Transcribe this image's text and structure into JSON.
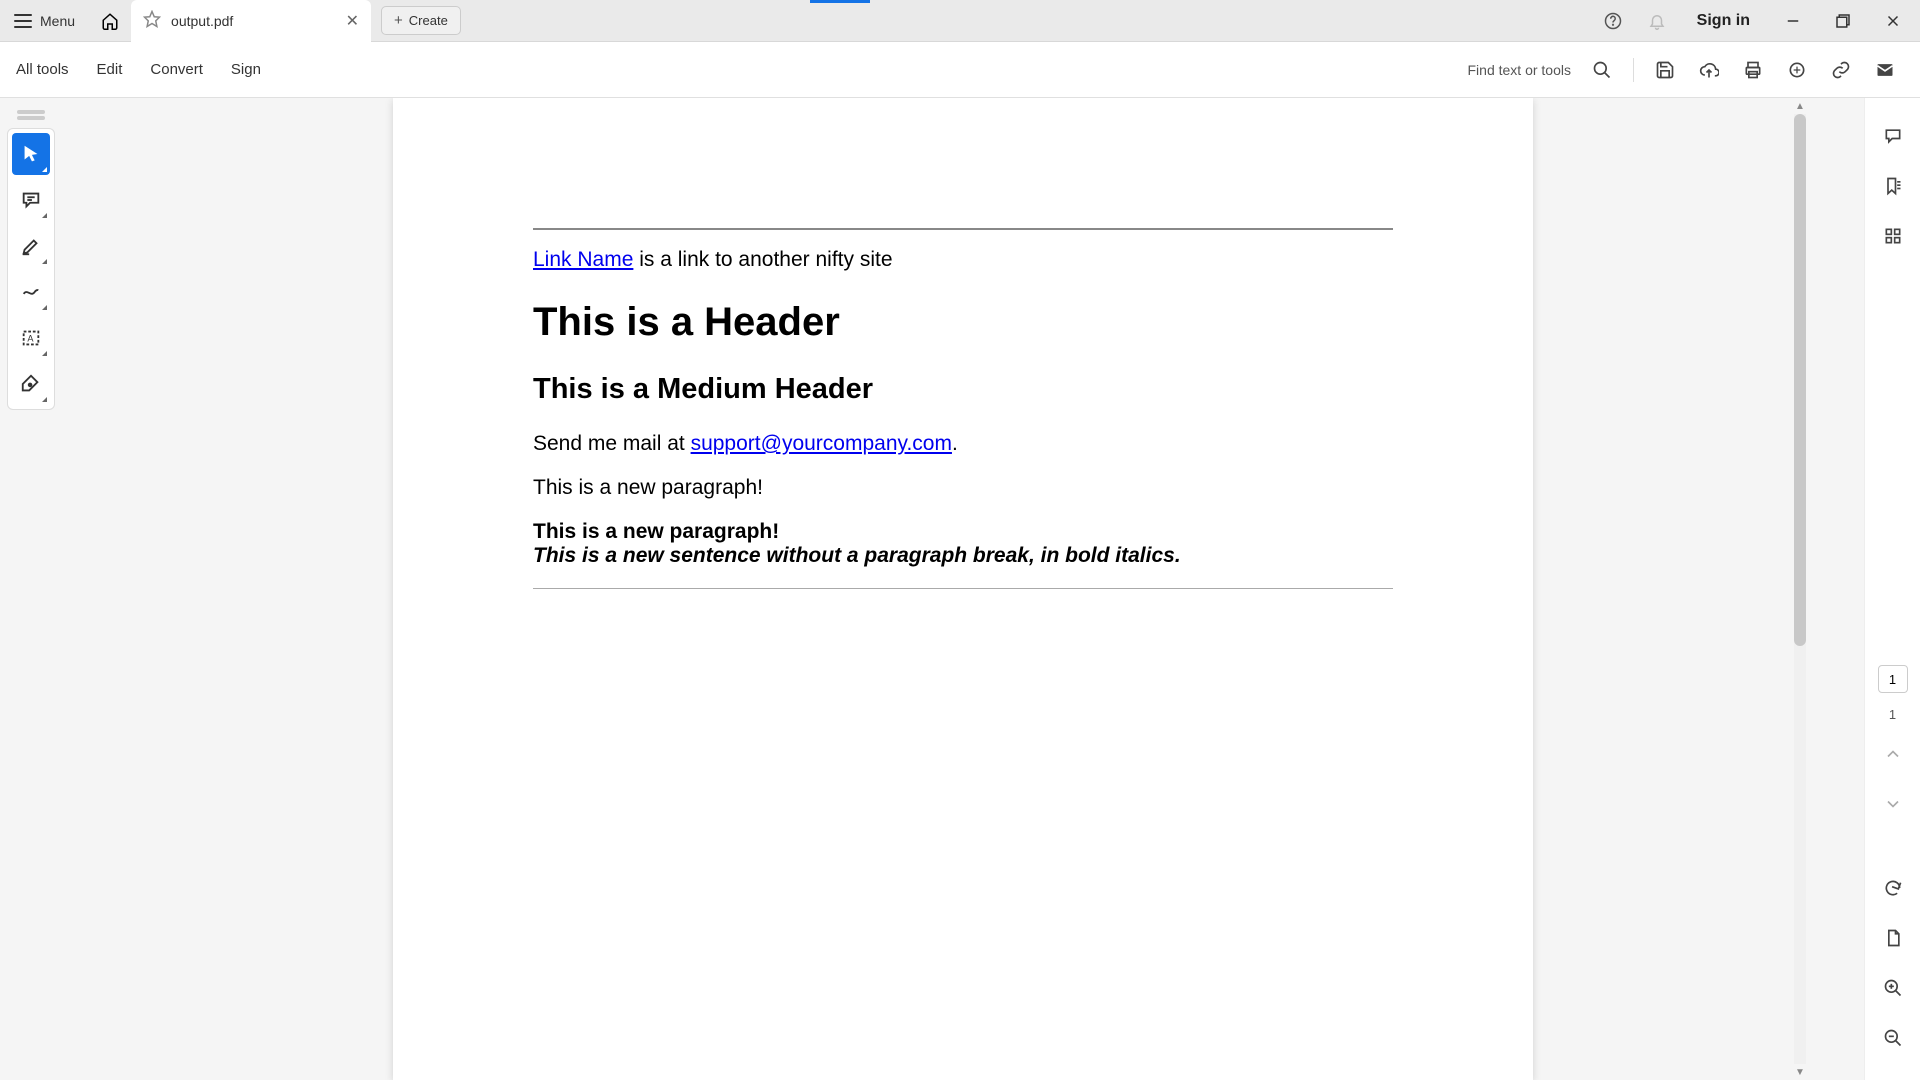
{
  "titlebar": {
    "menu_label": "Menu",
    "tab_title": "output.pdf",
    "create_label": "Create",
    "signin_label": "Sign in"
  },
  "toolbar": {
    "all_tools": "All tools",
    "edit": "Edit",
    "convert": "Convert",
    "sign": "Sign",
    "find_label": "Find text or tools"
  },
  "document": {
    "link_text": "Link Name",
    "link_suffix": " is a link to another nifty site",
    "header1": "This is a Header",
    "header2": "This is a Medium Header",
    "mail_prefix": "Send me mail at ",
    "mail_link": "support@yourcompany.com",
    "mail_suffix": ".",
    "para_new": "This is a new paragraph!",
    "para_bold": "This is a new paragraph!",
    "para_bold_italic": "This is a new sentence without a paragraph break, in bold italics."
  },
  "pagination": {
    "current": "1",
    "total": "1"
  }
}
